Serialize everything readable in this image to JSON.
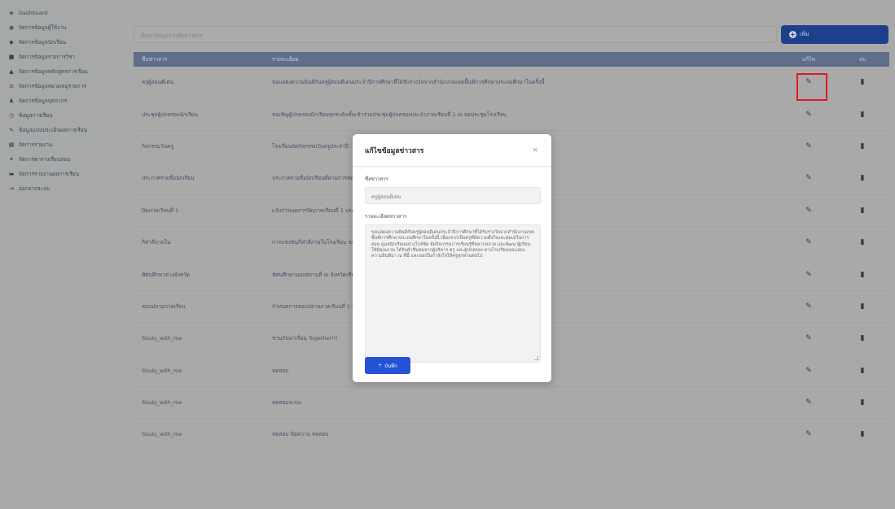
{
  "sidebar": {
    "items": [
      {
        "icon": "dashboard-icon",
        "glyph": "◈",
        "label": "Dashboard"
      },
      {
        "icon": "users-icon",
        "glyph": "◉",
        "label": "จัดการข้อมูลผู้ใช้งาน"
      },
      {
        "icon": "user-icon",
        "glyph": "◆",
        "label": "จัดการข้อมูลนักเรียน"
      },
      {
        "icon": "book-icon",
        "glyph": "■",
        "label": "จัดการข้อมูลรายการวิชา"
      },
      {
        "icon": "graduation-icon",
        "glyph": "▲",
        "label": "จัดการข้อมูลหลักสูตรการเรียน"
      },
      {
        "icon": "list-icon",
        "glyph": "≡",
        "label": "จัดการข้อมูลหมวดหมู่รายการ"
      },
      {
        "icon": "person-icon",
        "glyph": "♟",
        "label": "จัดการข้อมูลบุคลากร"
      },
      {
        "icon": "clock-icon",
        "glyph": "◷",
        "label": "ข้อมูลการเรียน"
      },
      {
        "icon": "pen-icon",
        "glyph": "✎",
        "label": "ข้อมูลแบบประเมินผลการเรียน"
      },
      {
        "icon": "grid-icon",
        "glyph": "▦",
        "label": "จัดการรายงาน"
      },
      {
        "icon": "settings-icon",
        "glyph": "✦",
        "label": "จัดการตารางเรียนสอบ"
      },
      {
        "icon": "chart-icon",
        "glyph": "▬",
        "label": "จัดการรายงานผลการเรียน"
      },
      {
        "icon": "logout-icon",
        "glyph": "⇥",
        "label": "ออกจากระบบ"
      }
    ]
  },
  "search": {
    "placeholder": "ค้นหาข้อมูลจากชื่อข่าวสาร"
  },
  "add_button": {
    "label": "เพิ่ม"
  },
  "table": {
    "headers": {
      "name": "ชื่อข่าวสาร",
      "detail": "รายละเอียด",
      "edit": "แก้ไข",
      "delete": "ลบ"
    },
    "rows": [
      {
        "name": "ครูผู้สอนดีเด่น",
        "detail": "ขอแสดงความยินดีกับครูผู้สอนดีเด่นประจำปีการศึกษาที่ได้รับรางวัลจากสำนักงานเขตพื้นที่การศึกษาประถมศึกษาในครั้งนี้"
      },
      {
        "name": "ประชุมผู้ปกครองนักเรียน",
        "detail": "ขอเชิญผู้ปกครองนักเรียนทุกระดับชั้นเข้าร่วมประชุมผู้ปกครองประจำภาคเรียนที่ 1 ณ หอประชุมโรงเรียน"
      },
      {
        "name": "กิจกรรมวันครู",
        "detail": "โรงเรียนจัดกิจกรรมวันครูประจำปี"
      },
      {
        "name": "ประกาศรายชื่อนักเรียน",
        "detail": "ประกาศรายชื่อนักเรียนที่ผ่านการคัดเลือกเข้าศึกษาต่อในระดับชั้นมัธยมศึกษาปีที่ 1 ประจำปีการศึกษา"
      },
      {
        "name": "ปิดภาคเรียนที่ 1",
        "detail": "แจ้งกำหนดการปิดภาคเรียนที่ 1 ประจำปีการศึกษา และกำหนดการเปิดภาคเรียนที่ 2 ให้ผู้ปกครองทราบ"
      },
      {
        "name": "กีฬาสีภายใน",
        "detail": "การแข่งขันกีฬาสีภายในโรงเรียน ขอเชิญผู้ปกครองร่วมเชียร์"
      },
      {
        "name": "ทัศนศึกษาต่างจังหวัด",
        "detail": "ทัศนศึกษานอกสถานที่ ณ จังหวัดเชียงใหม่ สำหรับนักเรียนชั้นประถมศึกษาปีที่ 6 ร่วมกับคณะครู"
      },
      {
        "name": "สอบปลายภาคเรียน",
        "detail": "กำหนดการสอบปลายภาคเรียนที่ 1 ขอให้นักเรียนเตรียมความพร้อม ตรวจสอบตารางสอบที่บอร์ดประชาสัมพันธ์"
      },
      {
        "name": "Study_with_me",
        "detail": "ชวนกันมาเรียน Together!!!"
      },
      {
        "name": "Study_with_me",
        "detail": "ทดสอบ"
      },
      {
        "name": "Study_with_me",
        "detail": "ทดสอบระบบ"
      },
      {
        "name": "Study_with_me",
        "detail": "ทดสอบ ข้อความ ทดสอบ"
      }
    ]
  },
  "modal": {
    "title": "แก้ไขข้อมูลข่าวสาร",
    "close": "×",
    "name_label": "ชื่อข่าวสาร",
    "name_value": "ครูผู้สอนดีเด่น",
    "detail_label": "รายละเอียดข่าวสาร",
    "detail_value": "ขอแสดงความยินดีกับครูผู้สอนดีเด่นประจำปีการศึกษาที่ได้รับรางวัลจากสำนักงานเขตพื้นที่การศึกษาประถมศึกษาในครั้งนี้ เนื่องจากเป็นครูที่มีความตั้งใจและทุ่มเทในการสอน ดูแลนักเรียนอย่างใกล้ชิด จัดกิจกรรมการเรียนรู้ที่หลากหลาย และพัฒนาผู้เรียนให้มีคุณภาพ ได้รับคำชื่นชมจากผู้บริหาร ครู และผู้ปกครอง ทางโรงเรียนขอแสดงความยินดีมา ณ ที่นี้ และขอเป็นกำลังใจให้ครูทุกท่านต่อไป",
    "save_label": "บันทึก"
  }
}
